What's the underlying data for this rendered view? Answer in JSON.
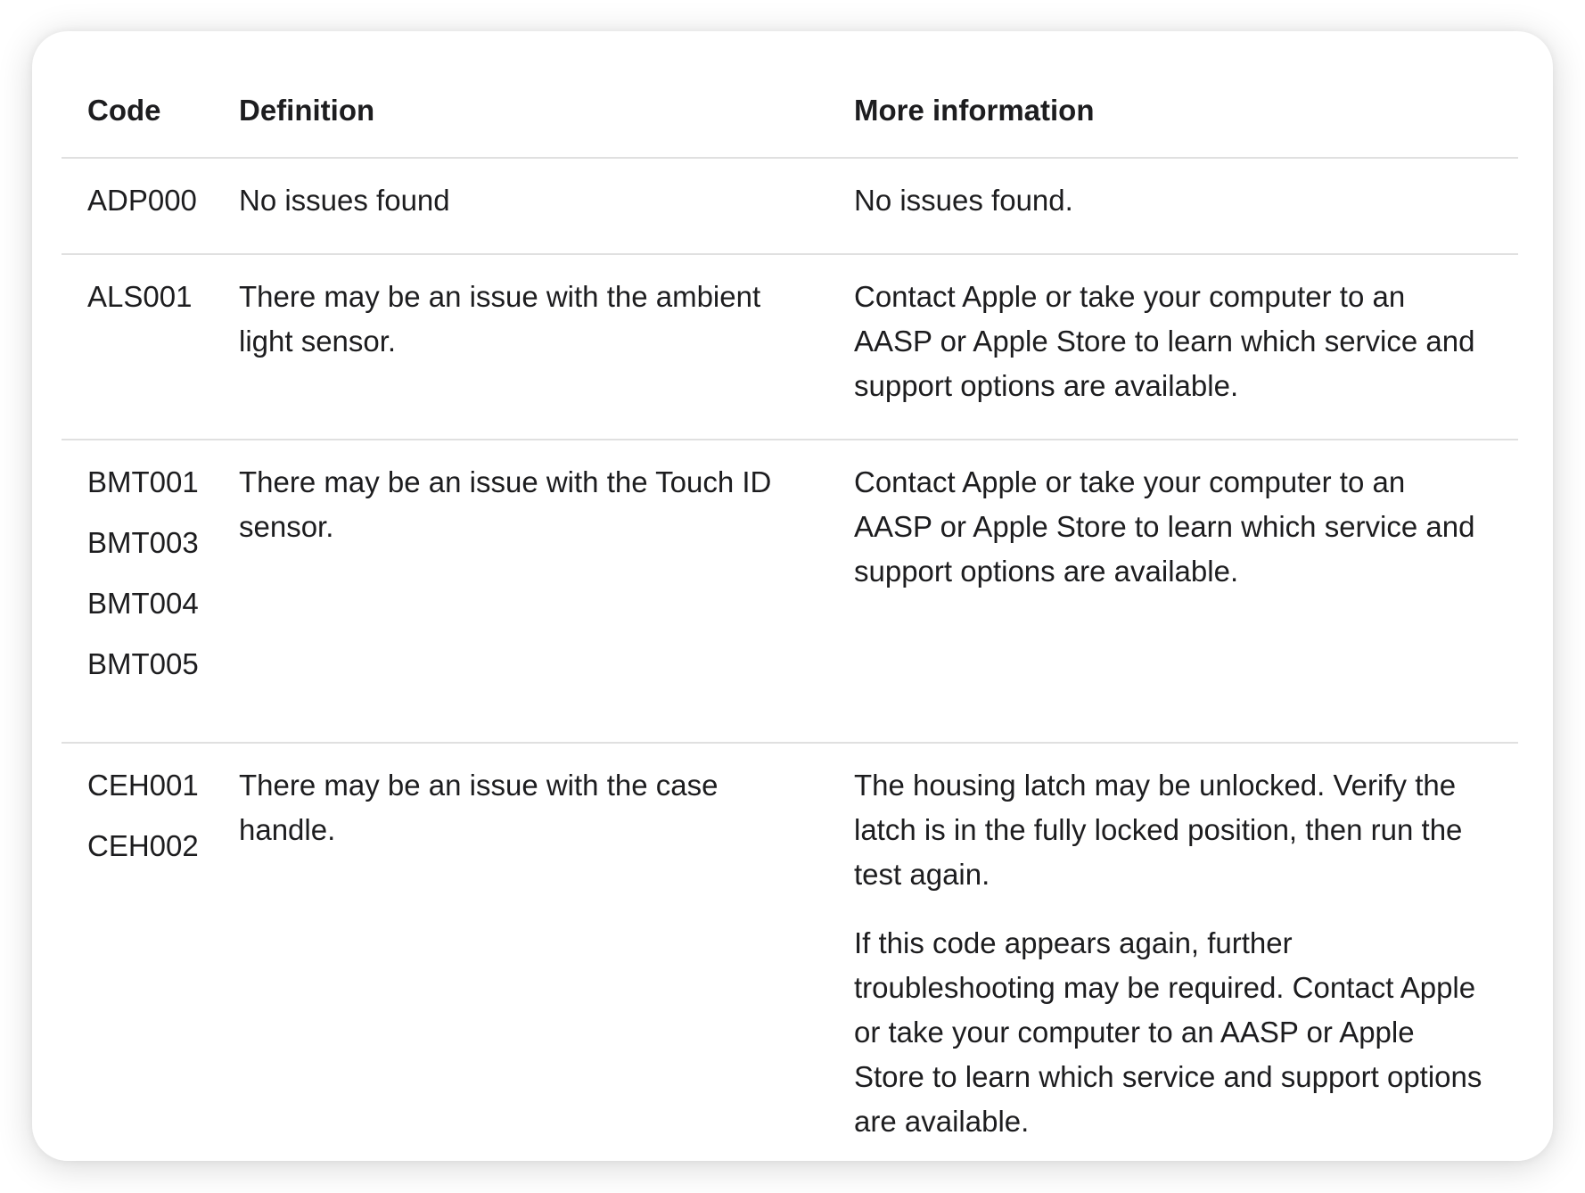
{
  "table": {
    "headers": {
      "code": "Code",
      "definition": "Definition",
      "more_info": "More information"
    },
    "rows": [
      {
        "codes": [
          "ADP000"
        ],
        "definition": "No issues found",
        "more_info": [
          "No issues found."
        ]
      },
      {
        "codes": [
          "ALS001"
        ],
        "definition": "There may be an issue with the ambient light sensor.",
        "more_info": [
          "Contact Apple or take your computer to an AASP or Apple Store to learn which service and support options are available."
        ]
      },
      {
        "codes": [
          "BMT001",
          "BMT003",
          "BMT004",
          "BMT005"
        ],
        "definition": "There may be an issue with the Touch ID sensor.",
        "more_info": [
          "Contact Apple or take your computer to an AASP or Apple Store to learn which service and support options are available."
        ]
      },
      {
        "codes": [
          "CEH001",
          "CEH002"
        ],
        "definition": "There may be an issue with the case handle.",
        "more_info": [
          "The housing latch may be unlocked. Verify the latch is in the fully locked position, then run the test again.",
          "If this code appears again, further troubleshooting may be required. Contact Apple or take your computer to an AASP or Apple Store to learn which service and support options are available."
        ]
      }
    ]
  }
}
